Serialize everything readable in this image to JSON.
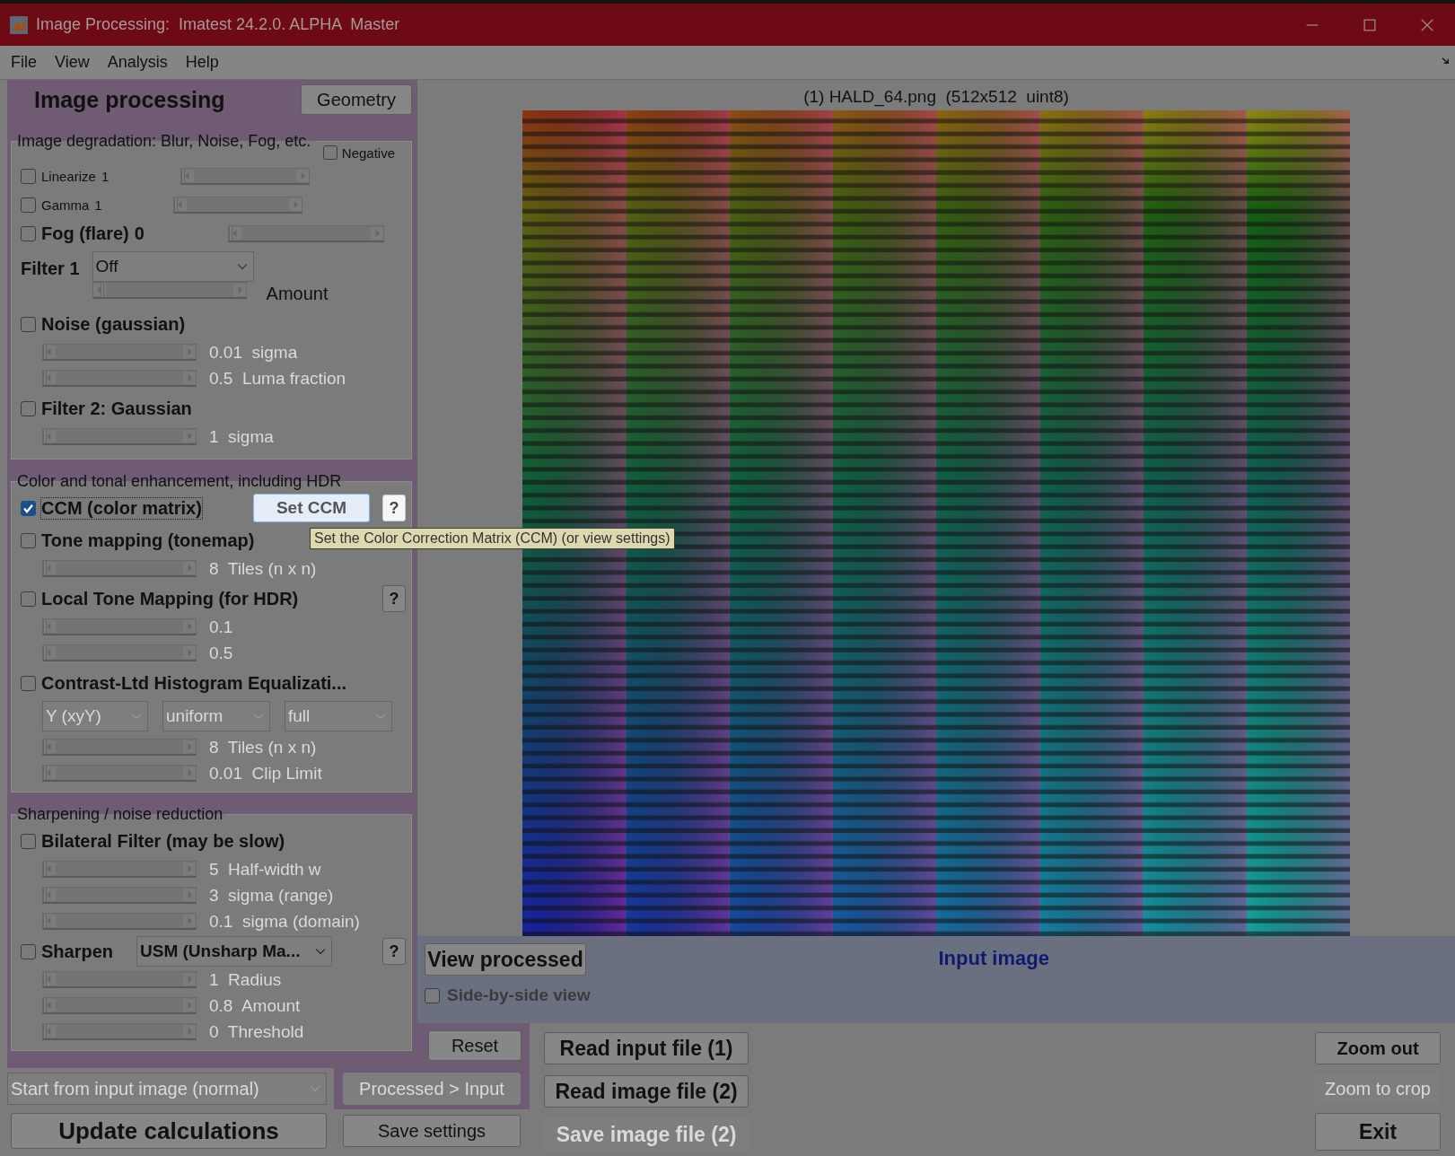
{
  "window": {
    "title": "Image Processing:  Imatest 24.2.0. ALPHA  Master"
  },
  "menu": [
    {
      "label": "File"
    },
    {
      "label": "View"
    },
    {
      "label": "Analysis"
    },
    {
      "label": "Help"
    }
  ],
  "panel": {
    "title": "Image processing",
    "geometry_button": "Geometry",
    "sections": [
      {
        "title": "Image degradation: Blur, Noise, Fog, etc.",
        "items": [
          {
            "kind": "option",
            "label": "Negative",
            "checked": false
          },
          {
            "kind": "inline",
            "label": "Linearize",
            "value": "1",
            "checked": false,
            "bold": false,
            "level": 0
          },
          {
            "kind": "inline",
            "label": "Gamma",
            "value": "1",
            "checked": false,
            "bold": false,
            "level": 0
          },
          {
            "kind": "inline",
            "label": "Fog (flare)",
            "value": "0",
            "checked": false,
            "bold": true,
            "level": 0
          },
          {
            "kind": "filter",
            "label": "Filter 1",
            "select": "Off",
            "level": 0.05,
            "caption": "Amount"
          },
          {
            "kind": "check",
            "label": "Noise (gaussian)",
            "checked": false
          },
          {
            "kind": "slider",
            "reading": "0.01  sigma",
            "level": 0,
            "disabled": true
          },
          {
            "kind": "slider",
            "reading": "0.5  Luma fraction",
            "level": 0,
            "disabled": true
          },
          {
            "kind": "check",
            "label": "Filter 2:  Gaussian",
            "checked": false
          },
          {
            "kind": "slider",
            "reading": "1  sigma",
            "level": 0,
            "disabled": true
          }
        ]
      },
      {
        "title": "Color and tonal enhancement, including HDR",
        "items": [
          {
            "kind": "check",
            "label": "CCM (color matrix)",
            "checked": true,
            "button": "Set CCM",
            "help": "?"
          },
          {
            "kind": "check",
            "label": "Tone mapping (tonemap)",
            "checked": false
          },
          {
            "kind": "slider",
            "reading": "8  Tiles (n x n)",
            "level": 0,
            "disabled": true
          },
          {
            "kind": "check",
            "label": "Local Tone Mapping (for HDR)",
            "checked": false,
            "help": "?"
          },
          {
            "kind": "slider",
            "reading": "0.1",
            "level": 0,
            "disabled": true
          },
          {
            "kind": "slider",
            "reading": "0.5",
            "level": 0,
            "disabled": true
          },
          {
            "kind": "check",
            "label": "Contrast-Ltd Histogram Equalizati...",
            "checked": false
          },
          {
            "kind": "selects",
            "options": [
              {
                "value": "Y (xyY)",
                "disabled": true
              },
              {
                "value": "uniform",
                "disabled": true
              },
              {
                "value": "full",
                "disabled": true
              }
            ]
          },
          {
            "kind": "slider",
            "reading": "8  Tiles (n x n)",
            "level": 0,
            "disabled": true
          },
          {
            "kind": "slider",
            "reading": "0.01  Clip Limit",
            "level": 0,
            "disabled": true
          }
        ]
      },
      {
        "title": "Sharpening / noise reduction",
        "items": [
          {
            "kind": "check",
            "label": "Bilateral Filter  (may be slow)",
            "checked": false
          },
          {
            "kind": "slider",
            "reading": "5  Half-width w",
            "level": 0,
            "disabled": true
          },
          {
            "kind": "slider",
            "reading": "3  sigma (range)",
            "level": 0,
            "disabled": true
          },
          {
            "kind": "slider",
            "reading": "0.1  sigma (domain)",
            "level": 0,
            "disabled": true
          },
          {
            "kind": "check",
            "label": "Sharpen",
            "checked": false,
            "select": "USM (Unsharp Ma...",
            "help": "?"
          },
          {
            "kind": "slider",
            "reading": "1  Radius",
            "level": 0,
            "disabled": true
          },
          {
            "kind": "slider",
            "reading": "0.8  Amount",
            "level": 0,
            "disabled": true
          },
          {
            "kind": "slider",
            "reading": "0  Threshold",
            "level": 0,
            "disabled": true
          }
        ]
      }
    ]
  },
  "tooltip": "Set the Color Correction Matrix (CCM) (or view settings)",
  "image": {
    "title": "(1) HALD_64.png  (512x512  uint8)"
  },
  "view": {
    "button": "View processed",
    "label": "Input image",
    "side_by_side": {
      "label": "Side-by-side view",
      "checked": false
    }
  },
  "reset": {
    "label": "Reset",
    "disabled": false
  },
  "start_select": {
    "value": "Start from input image (normal)",
    "disabled": true
  },
  "processed_to_input": {
    "label": "Processed > Input",
    "disabled": true
  },
  "update": {
    "label": "Update calculations",
    "disabled": false
  },
  "save_settings": {
    "label": "Save settings",
    "disabled": false
  },
  "file_buttons": [
    {
      "label": "Read input file (1)",
      "disabled": false
    },
    {
      "label": "Read image file (2)",
      "disabled": false
    },
    {
      "label": "Save image file (2)",
      "disabled": true
    }
  ],
  "zoom_buttons": [
    {
      "label": "Zoom out",
      "disabled": false
    },
    {
      "label": "Zoom to crop",
      "disabled": true
    },
    {
      "label": "Exit",
      "disabled": false
    }
  ]
}
